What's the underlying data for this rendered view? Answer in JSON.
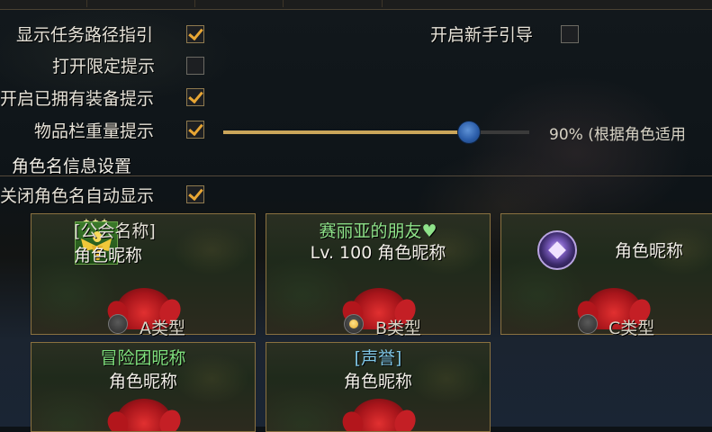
{
  "options": {
    "show_quest_path": {
      "label": "显示任务路径指引",
      "checked": true
    },
    "newbie_guide": {
      "label": "开启新手引导",
      "checked": false
    },
    "limited_tip": {
      "label": "打开限定提示",
      "checked": false
    },
    "owned_equip_tip": {
      "label": "开启已拥有装备提示",
      "checked": true
    },
    "inventory_weight_tip": {
      "label": "物品栏重量提示",
      "checked": true
    }
  },
  "weight_slider": {
    "value_percent": 90,
    "text": "90% (根据角色适用"
  },
  "name_section": {
    "title": "角色名信息设置"
  },
  "auto_hide_name": {
    "label": "关闭角色名自动显示",
    "checked": true
  },
  "name_types": [
    {
      "line1": "[公会名称]",
      "line2": "角色昵称",
      "line1_color": "#f1eee6",
      "icon": "guild-eagle-icon",
      "radio_label": "A类型",
      "selected": false
    },
    {
      "line1": "赛丽亚的朋友♥",
      "line2": "Lv. 100 角色昵称",
      "line1_color": "#8fe38a",
      "icon": "",
      "radio_label": "B类型",
      "selected": true
    },
    {
      "line1": "",
      "line2": "角色昵称",
      "line1_color": "#f1eee6",
      "icon": "medal-icon",
      "radio_label": "C类型",
      "selected": false
    }
  ],
  "name_types_row2": [
    {
      "line1": "冒险团昵称",
      "line2": "角色昵称",
      "line1_color": "#7fe07d"
    },
    {
      "line1": "[声誉]",
      "line2": "角色昵称",
      "line1_color": "#7fc6e6"
    }
  ],
  "colors": {
    "accent": "#e8a634",
    "border": "#8a7140",
    "slider_fill": "#caa55a",
    "knob": "#2c5eaa"
  }
}
